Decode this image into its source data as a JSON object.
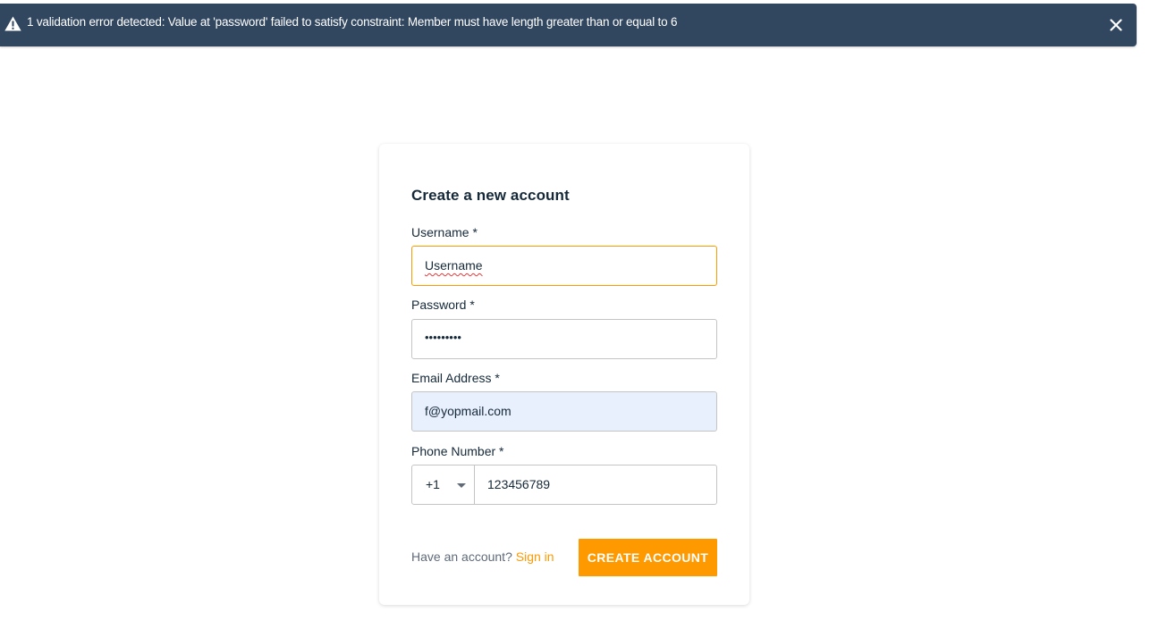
{
  "alert": {
    "message": "1 validation error detected: Value at 'password' failed to satisfy constraint: Member must have length greater than or equal to 6",
    "icon": "warning-icon",
    "close_icon": "close-icon",
    "background": "#31465f"
  },
  "form": {
    "title": "Create a new account",
    "username": {
      "label": "Username *",
      "value": "Username"
    },
    "password": {
      "label": "Password *",
      "value": "•••••••••"
    },
    "email": {
      "label": "Email Address *",
      "value": "f@yopmail.com"
    },
    "phone": {
      "label": "Phone Number *",
      "dial_code": "+1",
      "value": "123456789"
    },
    "signin_prompt": "Have an account?",
    "signin_link": "Sign in",
    "submit_label": "CREATE ACCOUNT",
    "accent": "#ff9900"
  }
}
